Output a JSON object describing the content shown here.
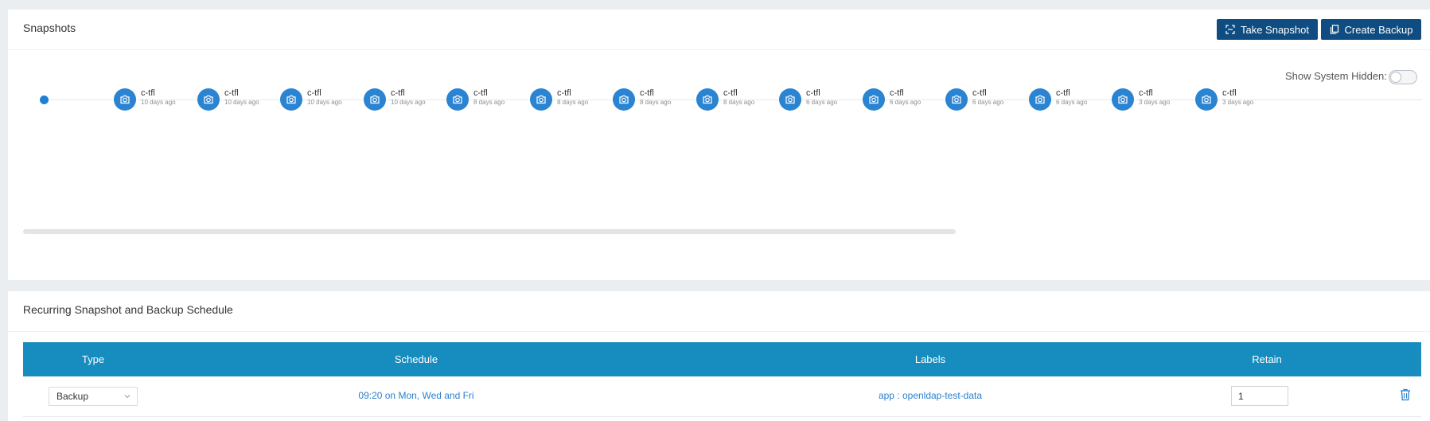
{
  "snapshots_panel": {
    "title": "Snapshots",
    "take_snapshot_label": "Take Snapshot",
    "create_backup_label": "Create Backup",
    "show_system_hidden_label": "Show System Hidden:",
    "show_system_hidden_on": false,
    "snapshots": [
      {
        "name": "c-tfl",
        "age": "10 days ago"
      },
      {
        "name": "c-tfl",
        "age": "10 days ago"
      },
      {
        "name": "c-tfl",
        "age": "10 days ago"
      },
      {
        "name": "c-tfl",
        "age": "10 days ago"
      },
      {
        "name": "c-tfl",
        "age": "8 days ago"
      },
      {
        "name": "c-tfl",
        "age": "8 days ago"
      },
      {
        "name": "c-tfl",
        "age": "8 days ago"
      },
      {
        "name": "c-tfl",
        "age": "8 days ago"
      },
      {
        "name": "c-tfl",
        "age": "6 days ago"
      },
      {
        "name": "c-tfl",
        "age": "6 days ago"
      },
      {
        "name": "c-tfl",
        "age": "6 days ago"
      },
      {
        "name": "c-tfl",
        "age": "6 days ago"
      },
      {
        "name": "c-tfl",
        "age": "3 days ago"
      },
      {
        "name": "c-tfl",
        "age": "3 days ago"
      }
    ]
  },
  "schedule_panel": {
    "title": "Recurring Snapshot and Backup Schedule",
    "columns": {
      "type": "Type",
      "schedule": "Schedule",
      "labels": "Labels",
      "retain": "Retain"
    },
    "rows": [
      {
        "type": "Backup",
        "schedule": "09:20 on Mon, Wed and Fri",
        "labels": "app : openldap-test-data",
        "retain": "1"
      }
    ]
  },
  "colors": {
    "primary_button": "#0f4c81",
    "table_header": "#178cbf",
    "snapshot_node": "#2b84d2",
    "link": "#2a7fce",
    "page_background": "#ebeef0"
  }
}
